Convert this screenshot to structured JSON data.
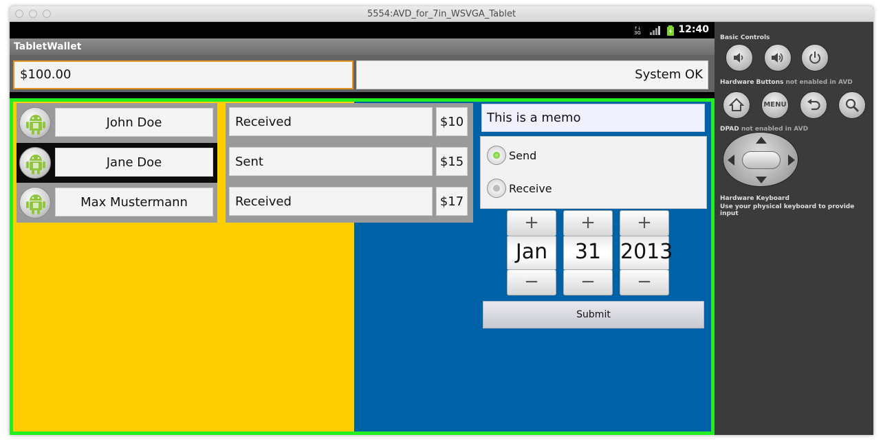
{
  "window": {
    "title": "5554:AVD_for_7in_WSVGA_Tablet"
  },
  "statusbar": {
    "time": "12:40"
  },
  "app": {
    "title": "TabletWallet"
  },
  "top": {
    "balance": "$100.00",
    "status": "System OK"
  },
  "contacts": [
    {
      "name": "John Doe",
      "selected": false
    },
    {
      "name": "Jane Doe",
      "selected": true
    },
    {
      "name": "Max Mustermann",
      "selected": false
    }
  ],
  "transactions": [
    {
      "type": "Received",
      "amount": "$10"
    },
    {
      "type": "Sent",
      "amount": "$15"
    },
    {
      "type": "Received",
      "amount": "$17"
    }
  ],
  "memo": "This is a memo",
  "radio_options": [
    {
      "label": "Send",
      "checked": true
    },
    {
      "label": "Receive",
      "checked": false
    }
  ],
  "date": {
    "month": "Jan",
    "day": "31",
    "year": "2013",
    "plus": "+",
    "minus": "−"
  },
  "submit_label": "Submit",
  "emulator": {
    "basic_controls": "Basic Controls",
    "hardware_buttons": "Hardware Buttons",
    "hardware_buttons_note": "not enabled in AVD",
    "menu": "MENU",
    "dpad": "DPAD",
    "dpad_note": "not enabled in AVD",
    "keyboard": "Hardware Keyboard",
    "keyboard_note": "Use your physical keyboard to provide input"
  },
  "colors": {
    "yellow": "#ffce00",
    "blue": "#0062a6",
    "frame_green": "#22ee22",
    "focus_orange": "#e69320"
  }
}
